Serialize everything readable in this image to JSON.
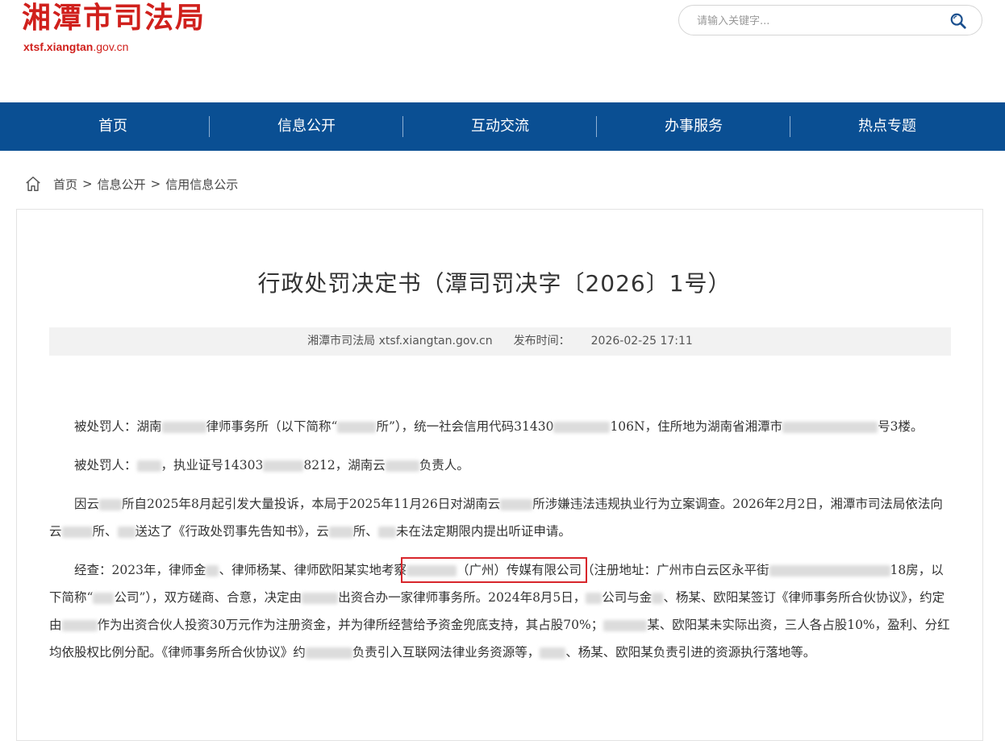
{
  "header": {
    "site_title": "湘潭市司法局",
    "site_url_bold": "xtsf.xiangtan",
    "site_url_rest": ".gov.cn",
    "search_placeholder": "请输入关键字..."
  },
  "nav": {
    "items": [
      "首页",
      "信息公开",
      "互动交流",
      "办事服务",
      "热点专题"
    ]
  },
  "breadcrumb": {
    "items": [
      "首页",
      "信息公开",
      "信用信息公示"
    ],
    "separator": ">"
  },
  "article": {
    "title": "行政处罚决定书（潭司罚决字〔2026〕1号）",
    "source": "湘潭市司法局 xtsf.xiangtan.gov.cn",
    "publish_label": "发布时间：",
    "publish_time": "2026-02-25 17:11",
    "p1": {
      "a": "被处罚人：湖南",
      "b": "律师事务所（以下简称“",
      "c": "所”），统一社会信用代码31430",
      "d": "106N，住所地为湖南省湘潭市",
      "e": "号",
      "f": "3楼。"
    },
    "p2": {
      "a": "被处罚人：",
      "b": "，执业证号14303",
      "c": "8212，湖南云",
      "d": "负责人。"
    },
    "p3": {
      "a": "因云",
      "b": "所自2025年8月起引发大量投诉，本局于2025年11月26日对湖南云",
      "c": "所涉嫌违法违规执业行为立案调查。2026年2月2日，湘潭市司法局依法向云",
      "d": "所、",
      "e": "送达了《行政处罚事先告知书》，云",
      "f": "所、",
      "g": "未在法定期限内提出听证申请。"
    },
    "p4": {
      "a": "经查：2023年，律师金",
      "b": "、律师杨某、律师欧阳某实地考察",
      "highlight": "（广州）传媒有限公司",
      "c": "（注册地址：广州市白云区永平街",
      "d": "18房，以下简称“",
      "e": "公司”），双方磋商、合意，决定由",
      "f": "出资合办一家律师事务所。2024年8月5日，",
      "g": "公司与金",
      "h": "、杨某、欧阳某签订《律师事务所合伙协议》，约定由",
      "i": "作为出资合伙人投资30万元作为注册资金，并为律所经营给予资金兜底支持，其占股70%；",
      "j": "某、欧阳某未实际出资，三人各占股10%，盈利、分红均依股权比例分配。《律师事务所合伙协议》约",
      "k": "负责引入互联网法律业务资源等，",
      "l": "、杨某、欧阳某负责引进的资源执行落地等。"
    }
  }
}
